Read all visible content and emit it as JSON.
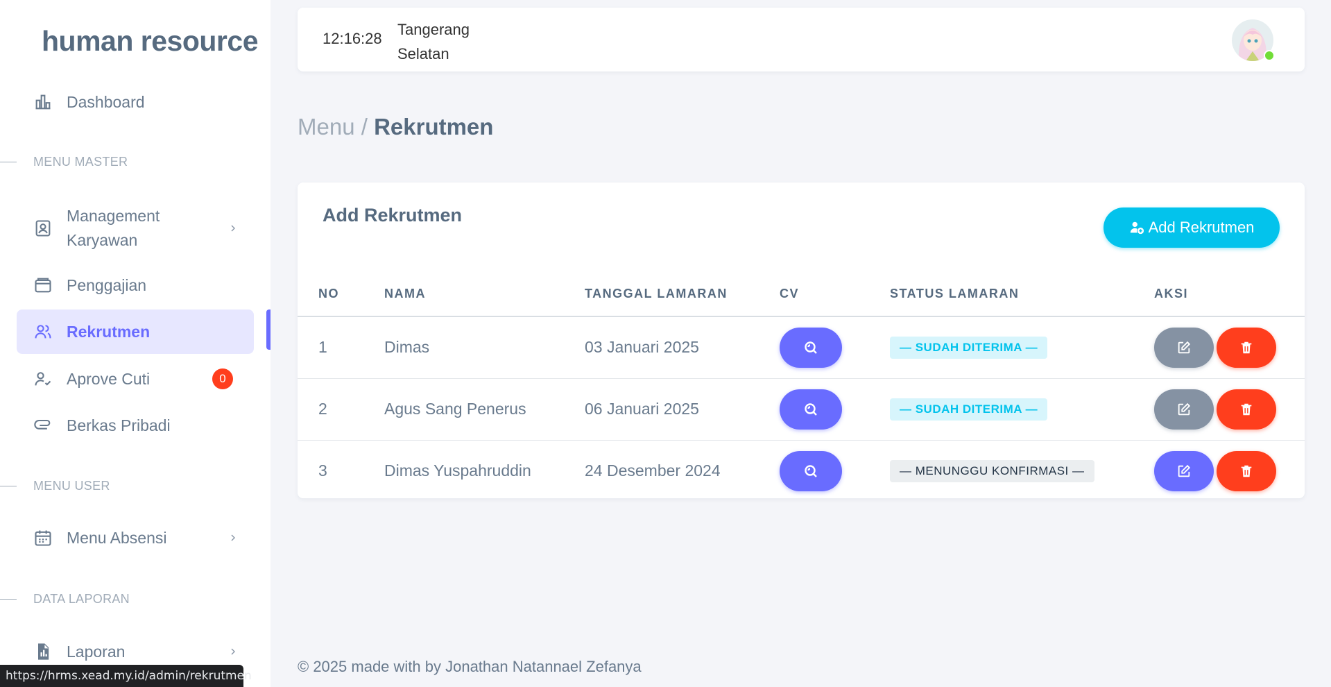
{
  "brand": "human resource",
  "sidebar": {
    "dashboard": "Dashboard",
    "section_master": "MENU MASTER",
    "management": "Management Karyawan",
    "penggajian": "Penggajian",
    "rekrutmen": "Rekrutmen",
    "aprove_cuti": "Aprove Cuti",
    "aprove_cuti_count": "0",
    "berkas": "Berkas Pribadi",
    "section_user": "MENU USER",
    "absensi": "Menu Absensi",
    "section_laporan": "DATA LAPORAN",
    "laporan": "Laporan"
  },
  "navbar": {
    "time": "12:16:28",
    "location": "Tangerang Selatan"
  },
  "breadcrumb": {
    "parent": "Menu /",
    "current": "Rekrutmen"
  },
  "card": {
    "title": "Add Rekrutmen",
    "add_button": "Add Rekrutmen",
    "columns": [
      "NO",
      "NAMA",
      "TANGGAL LAMARAN",
      "CV",
      "STATUS LAMARAN",
      "AKSI"
    ],
    "rows": [
      {
        "no": "1",
        "nama": "Dimas",
        "tanggal": "03 Januari 2025",
        "status": "— SUDAH DITERIMA —",
        "status_type": "accepted"
      },
      {
        "no": "2",
        "nama": "Agus Sang Penerus",
        "tanggal": "06 Januari 2025",
        "status": "— SUDAH DITERIMA —",
        "status_type": "accepted"
      },
      {
        "no": "3",
        "nama": "Dimas Yuspahruddin",
        "tanggal": "24 Desember 2024",
        "status": "— MENUNGGU KONFIRMASI —",
        "status_type": "waiting"
      }
    ]
  },
  "footer": "© 2025 made with by Jonathan Natannael Zefanya",
  "status_url": "https://hrms.xead.my.id/admin/rekrutmen",
  "colors": {
    "primary": "#696cff",
    "info": "#03c3ec",
    "danger": "#ff3e1d",
    "secondary": "#8592a3"
  }
}
